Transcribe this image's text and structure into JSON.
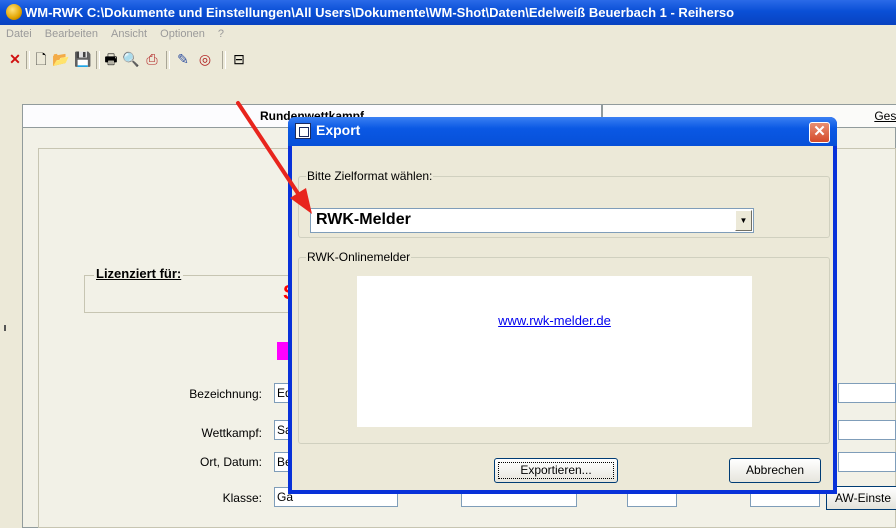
{
  "window": {
    "title": "WM-RWK C:\\Dokumente und Einstellungen\\All Users\\Dokumente\\WM-Shot\\Daten\\Edelweiß Beuerbach 1 - Reiherso",
    "menu": [
      "Datei",
      "Bearbeiten",
      "Ansicht",
      "Optionen",
      "?"
    ]
  },
  "toolbar": {
    "icons": [
      "close-icon",
      "new-file-icon",
      "open-folder-icon",
      "save-icon",
      "print-icon",
      "print-preview-icon",
      "export-icon",
      "tools-icon",
      "target-icon",
      "list-icon"
    ],
    "glyphs": [
      "✕",
      "🗋",
      "📂",
      "💾",
      "🖶",
      "🔍",
      "⎙",
      "✎",
      "◎",
      "⊟"
    ]
  },
  "tabs": [
    "Rundenwettkampf",
    "Gesa"
  ],
  "main": {
    "licensed_label": "Lizenziert für:",
    "licensed_value_fragment": "S",
    "fields": [
      {
        "label": "Bezeichnung:",
        "value": "Ed"
      },
      {
        "label": "Wettkampf:",
        "value": "Sa"
      },
      {
        "label": "Ort, Datum:",
        "value": "Be"
      },
      {
        "label": "Klasse:",
        "value": "Ga"
      }
    ],
    "aw_button": "AW-Einste"
  },
  "dialog": {
    "title": "Export",
    "close_glyph": "✕",
    "format_group_label": "Bitte Zielformat wählen:",
    "format_selected": "RWK-Melder",
    "dropdown_arrow": "▼",
    "online_group_label": "RWK-Onlinemelder",
    "link_text": "www.rwk-melder.de",
    "export_button": "Exportieren...",
    "cancel_button": "Abbrechen"
  },
  "colors": {
    "titlebar": "#0a4fd6",
    "dialog_frame": "#0831d9",
    "close_button": "#d44a2a",
    "arrow": "#e8251d",
    "highlight_magenta": "#ff00ff",
    "license_red": "#ff0000"
  }
}
